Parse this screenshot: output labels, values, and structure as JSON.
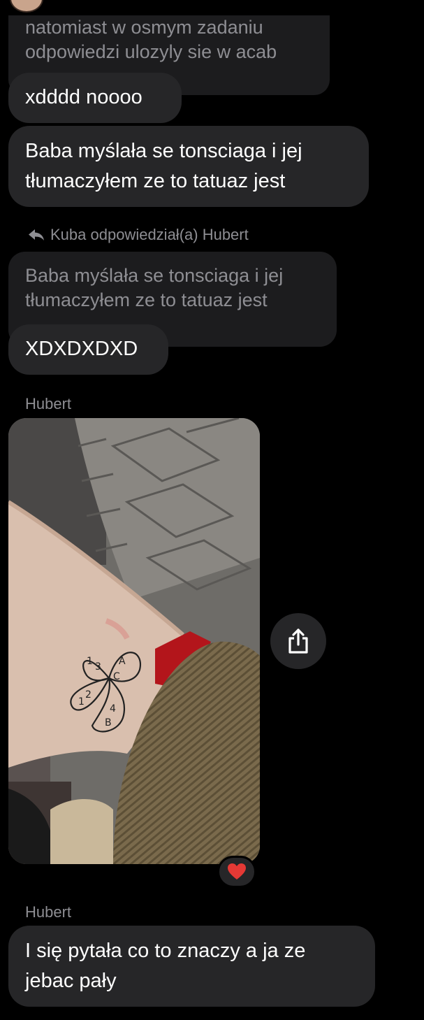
{
  "messages": {
    "quoted_top": {
      "line1": "natomiast w osmym zadaniu",
      "line2": "odpowiedzi ulozyly sie w acab"
    },
    "msg1": "xdddd noooo",
    "msg2": {
      "line1": "Baba myślała se tonsciaga i jej",
      "line2": "tłumaczyłem ze to tatuaz jest"
    },
    "reply_header": "Kuba odpowiedział(a) Hubert",
    "quoted_reply": {
      "line1": "Baba myślała se tonsciaga i jej",
      "line2": "tłumaczyłem ze to tatuaz jest"
    },
    "msg3": "XDXDXDXD",
    "sender1": "Hubert",
    "photo": {
      "tattoo_letters": [
        "A",
        "C",
        "1",
        "3",
        "1",
        "2",
        "4",
        "B"
      ]
    },
    "reaction": "heart",
    "sender2": "Hubert",
    "msg4": {
      "line1": "I się pytała co to znaczy a ja ze",
      "line2": "jebac pały"
    }
  },
  "icons": {
    "reply": "reply-arrow-icon",
    "share": "share-icon",
    "reaction": "heart-icon"
  },
  "colors": {
    "background": "#000000",
    "bubble": "#262628",
    "quoted_bubble": "#1c1c1e",
    "muted_text": "#8e8e93",
    "heart": "#e53935"
  }
}
